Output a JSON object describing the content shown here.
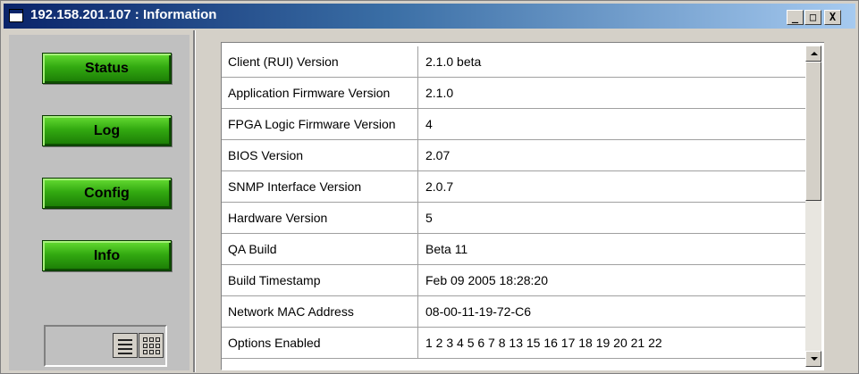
{
  "window": {
    "title": "192.158.201.107 : Information"
  },
  "titlebar_buttons": {
    "minimize": "_",
    "maximize": "□",
    "close": "X"
  },
  "nav": {
    "status": "Status",
    "log": "Log",
    "config": "Config",
    "info": "Info"
  },
  "view_icons": [
    "list-view-icon",
    "grid-view-icon"
  ],
  "info_rows": [
    {
      "name": "Client (RUI) Version",
      "value": "2.1.0 beta"
    },
    {
      "name": "Application Firmware Version",
      "value": "2.1.0"
    },
    {
      "name": "FPGA Logic Firmware Version",
      "value": "4"
    },
    {
      "name": "BIOS Version",
      "value": "2.07"
    },
    {
      "name": "SNMP Interface Version",
      "value": "2.0.7"
    },
    {
      "name": "Hardware Version",
      "value": "5"
    },
    {
      "name": "QA Build",
      "value": "Beta 11"
    },
    {
      "name": "Build Timestamp",
      "value": "Feb 09 2005 18:28:20"
    },
    {
      "name": "Network MAC Address",
      "value": "08-00-11-19-72-C6"
    },
    {
      "name": "Options Enabled",
      "value": "1 2 3 4 5 6 7 8 13 15 16 17 18 19 20 21 22"
    }
  ],
  "colors": {
    "titlebar": "#0a246a",
    "button_green": "#33aa11",
    "panel": "#c0c0c0"
  }
}
